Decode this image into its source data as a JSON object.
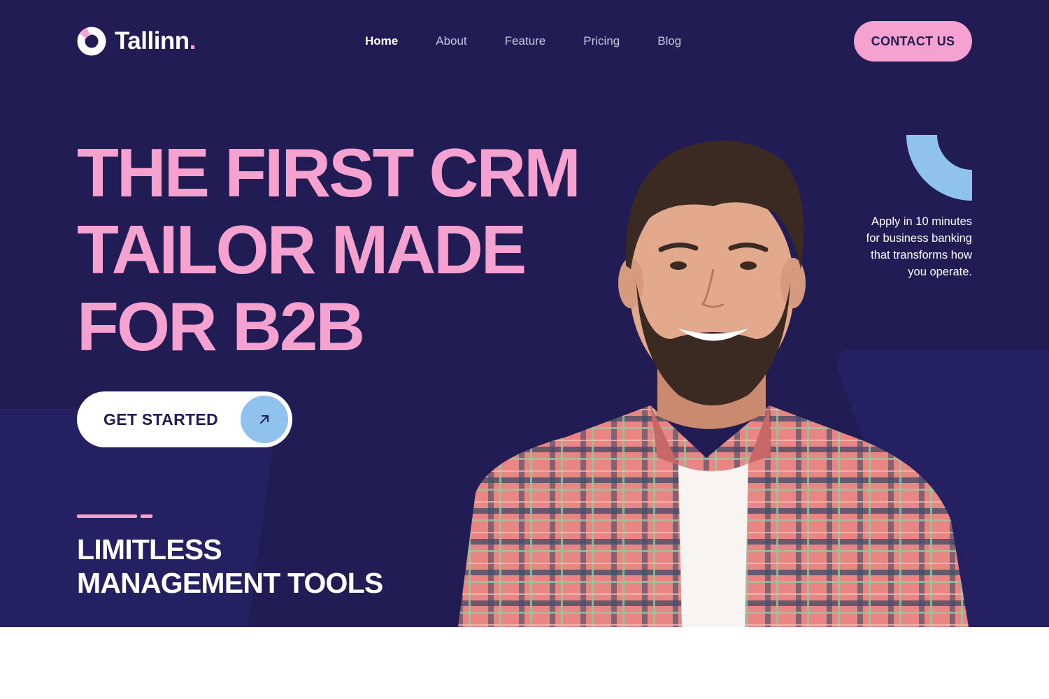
{
  "brand": {
    "name": "Tallinn",
    "dot": ".",
    "logo_icon": "ring-logo-icon",
    "colors": {
      "background": "#211c54",
      "accent_pink": "#f6a2d0",
      "accent_blue": "#8fc3ee",
      "text_white": "#ffffff"
    }
  },
  "nav": {
    "items": [
      {
        "label": "Home",
        "active": true
      },
      {
        "label": "About",
        "active": false
      },
      {
        "label": "Feature",
        "active": false
      },
      {
        "label": "Pricing",
        "active": false
      },
      {
        "label": "Blog",
        "active": false
      }
    ],
    "cta_label": "CONTACT US"
  },
  "hero": {
    "headline_lines": [
      "THE FIRST CRM",
      "TAILOR MADE",
      "FOR B2B"
    ],
    "cta_label": "GET STARTED",
    "cta_icon": "arrow-up-right-icon",
    "subheading_lines": [
      "LIMITLESS",
      "MANAGEMENT TOOLS"
    ],
    "side_text_lines": [
      "Apply in 10 minutes",
      "for business banking",
      "that transforms how",
      "you operate."
    ],
    "photo_icon": "smiling-man-portrait"
  }
}
